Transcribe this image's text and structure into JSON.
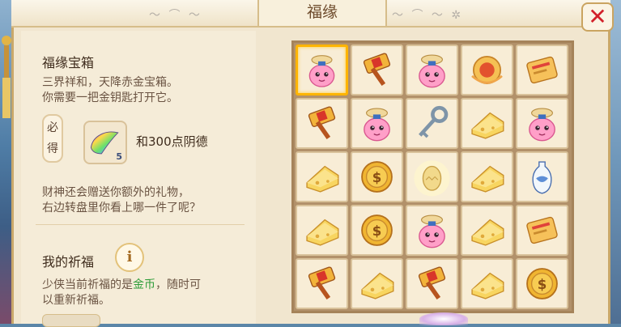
{
  "header": {
    "title": "福缘",
    "close_label": "✕"
  },
  "treasure": {
    "title": "福缘宝箱",
    "desc": "三界祥和，天降赤金宝箱。\n你需要一把金钥匙打开它。",
    "must_label": "必\n得",
    "gift_count": "5",
    "gift_text": "和300点阴德",
    "extra_desc": "财神还会赠送你额外的礼物，\n右边转盘里你看上哪一件了呢？"
  },
  "blessing": {
    "title": "我的祈福",
    "info_label": "i",
    "desc_prefix": "少侠当前祈福的是",
    "desc_highlight": "金币",
    "desc_suffix": "，随时可\n以重新祈福。"
  },
  "grid": [
    [
      "lucky-bag-pink",
      "golden-hammer",
      "lucky-bag-pink",
      "red-gem-coin",
      "scroll"
    ],
    [
      "golden-hammer",
      "lucky-bag-pink",
      "silver-key",
      "cheese-gold",
      "lucky-bag-pink"
    ],
    [
      "cheese-gold",
      "gold-coin",
      "golden-egg",
      "cheese-gold",
      "porcelain-vase"
    ],
    [
      "cheese-gold",
      "gold-coin",
      "lucky-bag-pink",
      "cheese-gold",
      "scroll"
    ],
    [
      "golden-hammer",
      "cheese-gold",
      "golden-hammer",
      "cheese-gold",
      "gold-coin"
    ]
  ],
  "selected_cell": [
    0,
    0
  ],
  "colors": {
    "accent": "#ffb400",
    "highlight": "#2f9d3a",
    "close": "#d2202a"
  }
}
